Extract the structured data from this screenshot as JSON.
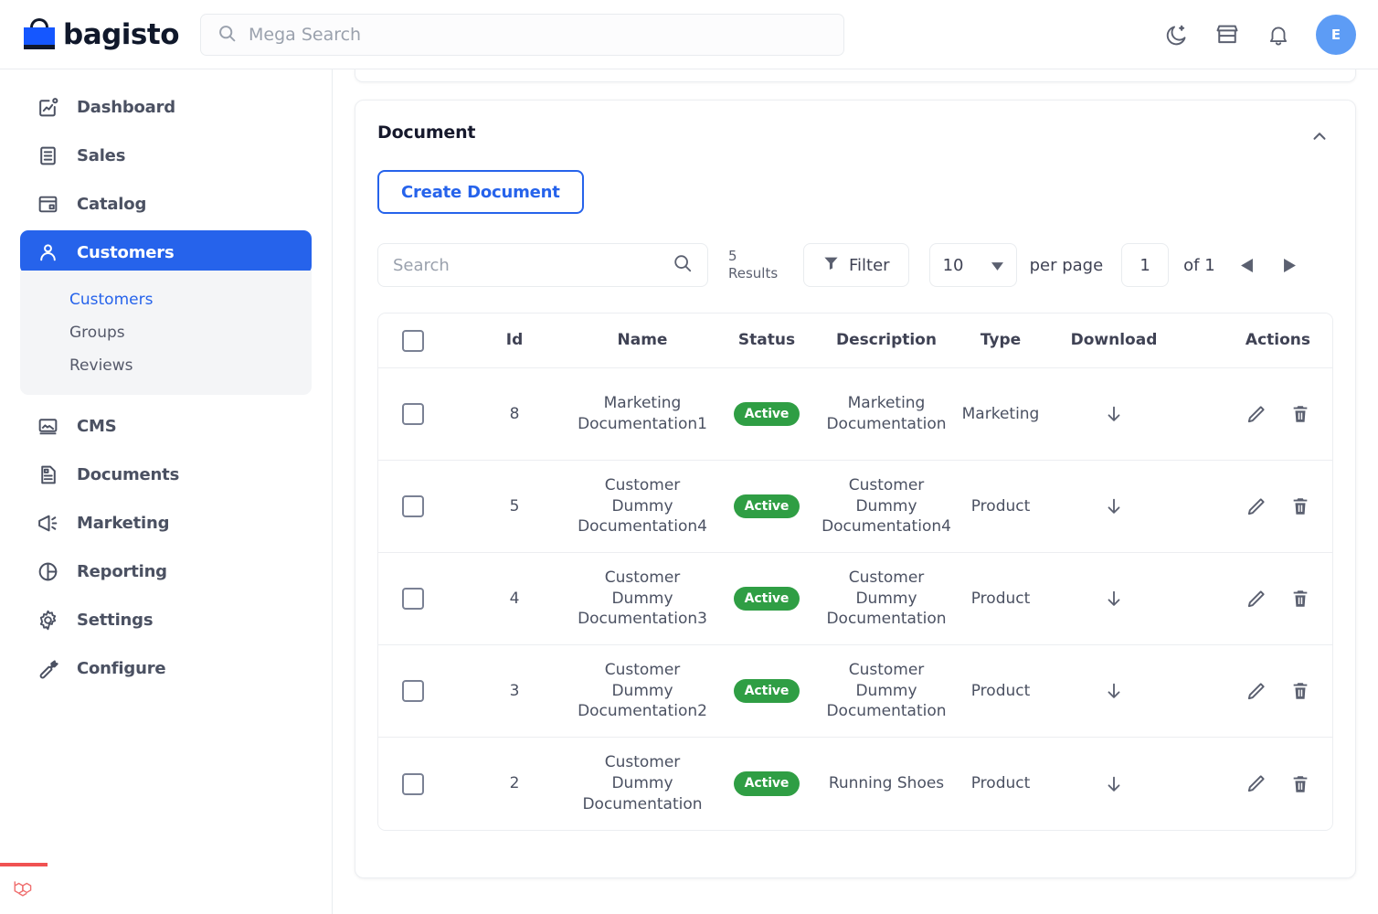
{
  "header": {
    "brand_name": "bagisto",
    "logo_icon": "shopping-bag-icon",
    "search_placeholder": "Mega Search",
    "search_value": "",
    "search_icon": "search-icon",
    "dark_mode_icon": "moon-icon",
    "store_icon": "store-icon",
    "notifications_icon": "bell-icon",
    "avatar_initial": "E"
  },
  "sidebar": {
    "items": [
      {
        "label": "Dashboard",
        "icon": "dashboard-chart-icon",
        "active": false
      },
      {
        "label": "Sales",
        "icon": "invoice-list-icon",
        "active": false
      },
      {
        "label": "Catalog",
        "icon": "catalog-window-icon",
        "active": false
      },
      {
        "label": "Customers",
        "icon": "user-icon",
        "active": true
      },
      {
        "label": "CMS",
        "icon": "image-frame-icon",
        "active": false
      },
      {
        "label": "Documents",
        "icon": "document-icon",
        "active": false
      },
      {
        "label": "Marketing",
        "icon": "megaphone-icon",
        "active": false
      },
      {
        "label": "Reporting",
        "icon": "pie-chart-icon",
        "active": false
      },
      {
        "label": "Settings",
        "icon": "gear-icon",
        "active": false
      },
      {
        "label": "Configure",
        "icon": "wrench-icon",
        "active": false
      }
    ],
    "submenu": [
      {
        "label": "Customers",
        "current": true
      },
      {
        "label": "Groups",
        "current": false
      },
      {
        "label": "Reviews",
        "current": false
      }
    ],
    "debugbar_icon": "laravel-icon"
  },
  "panel": {
    "title": "Document",
    "collapse_icon": "chevron-up-icon",
    "create_button_label": "Create Document"
  },
  "toolbar": {
    "search_placeholder": "Search",
    "search_value": "",
    "search_icon": "search-icon",
    "results_count": "5",
    "results_label": "Results",
    "filter_label": "Filter",
    "filter_icon": "funnel-icon",
    "per_page_value": "10",
    "per_page_caret_icon": "chevron-down-icon",
    "per_page_label": "per page",
    "page_value": "1",
    "of_label": "of 1",
    "prev_icon": "triangle-left-icon",
    "next_icon": "triangle-right-icon"
  },
  "table": {
    "columns": [
      "",
      "Id",
      "Name",
      "Status",
      "Description",
      "Type",
      "Download",
      "Actions"
    ],
    "select_all_checkbox": "unchecked",
    "download_icon": "arrow-down-icon",
    "edit_icon": "pencil-icon",
    "delete_icon": "trash-icon",
    "rows": [
      {
        "id": "8",
        "name": "Marketing Documentation1",
        "status": "Active",
        "description": "Marketing Documentation",
        "type": "Marketing"
      },
      {
        "id": "5",
        "name": "Customer Dummy Documentation4",
        "status": "Active",
        "description": "Customer Dummy Documentation4",
        "type": "Product"
      },
      {
        "id": "4",
        "name": "Customer Dummy Documentation3",
        "status": "Active",
        "description": "Customer Dummy Documentation",
        "type": "Product"
      },
      {
        "id": "3",
        "name": "Customer Dummy Documentation2",
        "status": "Active",
        "description": "Customer Dummy Documentation",
        "type": "Product"
      },
      {
        "id": "2",
        "name": "Customer Dummy Documentation",
        "status": "Active",
        "description": "Running Shoes",
        "type": "Product"
      }
    ]
  },
  "colors": {
    "accent_blue": "#2663eb",
    "brand_blue": "#1557ff",
    "status_green": "#2f9e44",
    "avatar_blue": "#5d9cf5",
    "debugbar_red": "#f05252"
  }
}
